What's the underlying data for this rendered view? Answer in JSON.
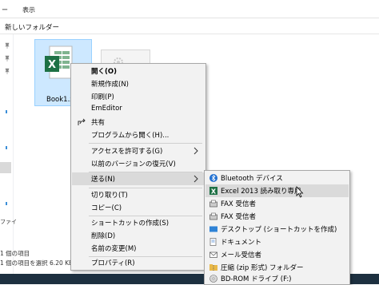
{
  "ribbon": {
    "tab_file": "ー",
    "tab_view": "表示"
  },
  "address": {
    "path": "新しいフォルダー"
  },
  "nav": {
    "item_label": "ファイ"
  },
  "status": {
    "items_count": "1 個の項目",
    "selection": "1 個の項目を選択  6.20 KB"
  },
  "files": [
    {
      "name": "Book1.x"
    }
  ],
  "context_menu": {
    "items": [
      {
        "label": "開く(O)",
        "bold": true
      },
      {
        "label": "新規作成(N)"
      },
      {
        "label": "印刷(P)"
      },
      {
        "label": "EmEditor"
      },
      {
        "label": "共有",
        "icon": "share-icon"
      },
      {
        "label": "プログラムから開く(H)..."
      },
      {
        "label": "アクセスを許可する(G)",
        "submenu": true
      },
      {
        "label": "以前のバージョンの復元(V)"
      },
      {
        "label": "送る(N)",
        "submenu": true,
        "highlighted": true
      },
      {
        "label": "切り取り(T)"
      },
      {
        "label": "コピー(C)"
      },
      {
        "label": "ショートカットの作成(S)"
      },
      {
        "label": "削除(D)"
      },
      {
        "label": "名前の変更(M)"
      },
      {
        "label": "プロパティ(R)"
      }
    ]
  },
  "send_to_menu": {
    "items": [
      {
        "label": "Bluetooth デバイス",
        "icon": "bluetooth-icon"
      },
      {
        "label": "Excel 2013 読み取り専用",
        "icon": "excel-icon",
        "highlighted": true
      },
      {
        "label": "FAX 受信者",
        "icon": "fax-icon"
      },
      {
        "label": "FAX 受信者",
        "icon": "fax-icon"
      },
      {
        "label": "デスクトップ (ショートカットを作成)",
        "icon": "desktop-icon"
      },
      {
        "label": "ドキュメント",
        "icon": "documents-icon"
      },
      {
        "label": "メール受信者",
        "icon": "mail-icon"
      },
      {
        "label": "圧縮 (zip 形式) フォルダー",
        "icon": "zip-folder-icon"
      },
      {
        "label": "BD-ROM ドライブ (F:)",
        "icon": "disc-drive-icon"
      }
    ]
  },
  "colors": {
    "selection": "#cde8ff",
    "menu_bg": "#f2f2f2",
    "highlight": "#dadada",
    "excel_green": "#1e7145",
    "taskbar": "#1d3040"
  }
}
